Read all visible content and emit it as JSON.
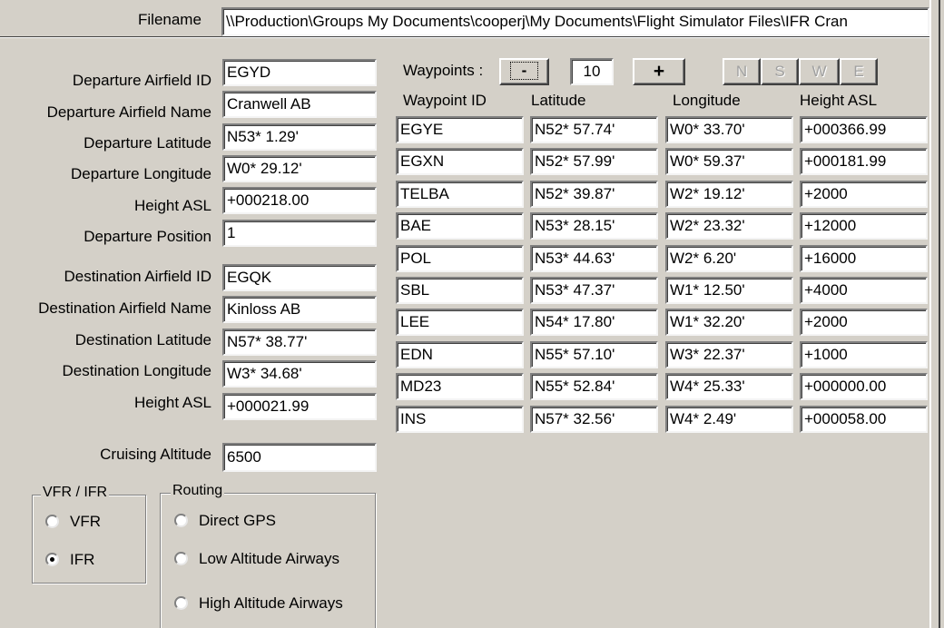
{
  "filename": {
    "label": "Filename",
    "value": "\\\\Production\\Groups My Documents\\cooperj\\My Documents\\Flight Simulator Files\\IFR Cran"
  },
  "departure": {
    "id_label": "Departure Airfield ID",
    "id": "EGYD",
    "name_label": "Departure Airfield Name",
    "name": "Cranwell AB",
    "lat_label": "Departure Latitude",
    "lat": "N53* 1.29'",
    "lon_label": "Departure Longitude",
    "lon": "W0* 29.12'",
    "height_label": "Height ASL",
    "height": "+000218.00",
    "position_label": "Departure Position",
    "position": "1"
  },
  "destination": {
    "id_label": "Destination Airfield ID",
    "id": "EGQK",
    "name_label": "Destination Airfield Name",
    "name": "Kinloss AB",
    "lat_label": "Destination Latitude",
    "lat": "N57* 38.77'",
    "lon_label": "Destination Longitude",
    "lon": "W3* 34.68'",
    "height_label": "Height ASL",
    "height": "+000021.99"
  },
  "cruising": {
    "label": "Cruising Altitude",
    "value": "6500"
  },
  "waypoints": {
    "label": "Waypoints :",
    "minus_label": "-",
    "count": "10",
    "plus_label": "+",
    "dir_buttons": [
      "N",
      "S",
      "W",
      "E"
    ],
    "columns": [
      "Waypoint ID",
      "Latitude",
      "Longitude",
      "Height ASL"
    ],
    "rows": [
      [
        "EGYE",
        "N52* 57.74'",
        "W0* 33.70'",
        "+000366.99"
      ],
      [
        "EGXN",
        "N52* 57.99'",
        "W0* 59.37'",
        "+000181.99"
      ],
      [
        "TELBA",
        "N52* 39.87'",
        "W2* 19.12'",
        "+2000"
      ],
      [
        "BAE",
        "N53* 28.15'",
        "W2* 23.32'",
        "+12000"
      ],
      [
        "POL",
        "N53* 44.63'",
        "W2* 6.20'",
        "+16000"
      ],
      [
        "SBL",
        "N53* 47.37'",
        "W1* 12.50'",
        "+4000"
      ],
      [
        "LEE",
        "N54* 17.80'",
        "W1* 32.20'",
        "+2000"
      ],
      [
        "EDN",
        "N55* 57.10'",
        "W3* 22.37'",
        "+1000"
      ],
      [
        "MD23",
        "N55* 52.84'",
        "W4* 25.33'",
        "+000000.00"
      ],
      [
        "INS",
        "N57* 32.56'",
        "W4* 2.49'",
        "+000058.00"
      ]
    ]
  },
  "flight_rules": {
    "legend": "VFR / IFR",
    "options": [
      "VFR",
      "IFR"
    ],
    "selected": "IFR"
  },
  "routing": {
    "legend": "Routing",
    "options": [
      "Direct GPS",
      "Low Altitude Airways",
      "High Altitude Airways"
    ],
    "selected": ""
  }
}
